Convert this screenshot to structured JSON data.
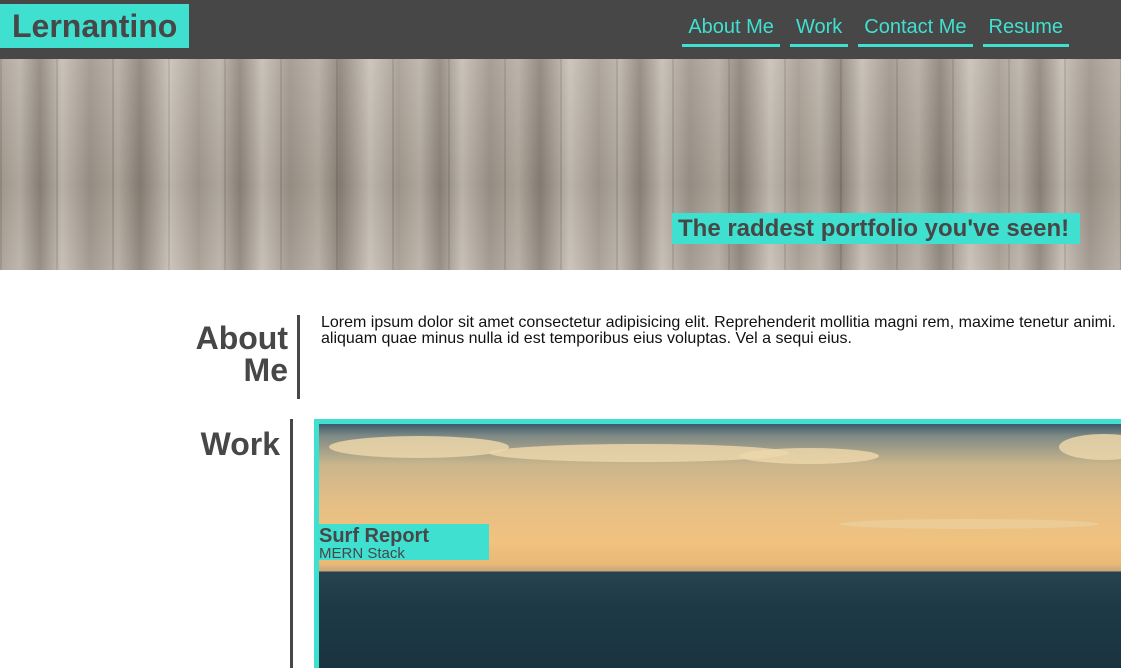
{
  "header": {
    "logo": "Lernantino",
    "nav": [
      {
        "label": "About Me"
      },
      {
        "label": "Work"
      },
      {
        "label": "Contact Me"
      },
      {
        "label": "Resume"
      }
    ]
  },
  "hero": {
    "tagline": "The raddest portfolio you've seen!"
  },
  "about": {
    "title": "About Me",
    "body": "Lorem ipsum dolor sit amet consectetur adipisicing elit. Reprehenderit mollitia magni rem, maxime tenetur animi. aliquam quae minus nulla id est temporibus eius voluptas. Vel a sequi eius."
  },
  "work": {
    "title": "Work",
    "projects": [
      {
        "name": "Surf Report",
        "stack": "MERN Stack"
      }
    ]
  },
  "colors": {
    "accent": "#40e0d0",
    "header_bg": "#474747",
    "text_dark": "#474747"
  }
}
